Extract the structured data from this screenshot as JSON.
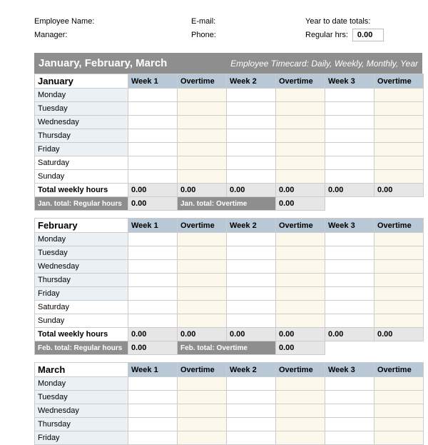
{
  "header": {
    "employee_name_label": "Employee Name:",
    "email_label": "E-mail:",
    "ytd_label": "Year to date totals:",
    "manager_label": "Manager:",
    "phone_label": "Phone:",
    "regular_hrs_label": "Regular hrs:",
    "regular_hrs_value": "0.00"
  },
  "banner": {
    "title": "January, February, March",
    "subtitle": "Employee Timecard: Daily, Weekly, Monthly, Year"
  },
  "columns": {
    "week1": "Week 1",
    "overtime": "Overtime",
    "week2": "Week 2",
    "week3": "Week 3"
  },
  "days": {
    "mon": "Monday",
    "tue": "Tuesday",
    "wed": "Wednesday",
    "thu": "Thursday",
    "fri": "Friday",
    "sat": "Saturday",
    "sun": "Sunday"
  },
  "months": {
    "jan": {
      "name": "January",
      "totals_label": "Total weekly hours",
      "w1": "0.00",
      "o1": "0.00",
      "w2": "0.00",
      "o2": "0.00",
      "w3": "0.00",
      "o3": "0.00",
      "reg_label": "Jan. total: Regular hours",
      "reg_value": "0.00",
      "ot_label": "Jan. total: Overtime",
      "ot_value": "0.00"
    },
    "feb": {
      "name": "February",
      "totals_label": "Total weekly hours",
      "w1": "0.00",
      "o1": "0.00",
      "w2": "0.00",
      "o2": "0.00",
      "w3": "0.00",
      "o3": "0.00",
      "reg_label": "Feb. total: Regular hours",
      "reg_value": "0.00",
      "ot_label": "Feb.  total: Overtime",
      "ot_value": "0.00"
    },
    "mar": {
      "name": "March"
    }
  }
}
